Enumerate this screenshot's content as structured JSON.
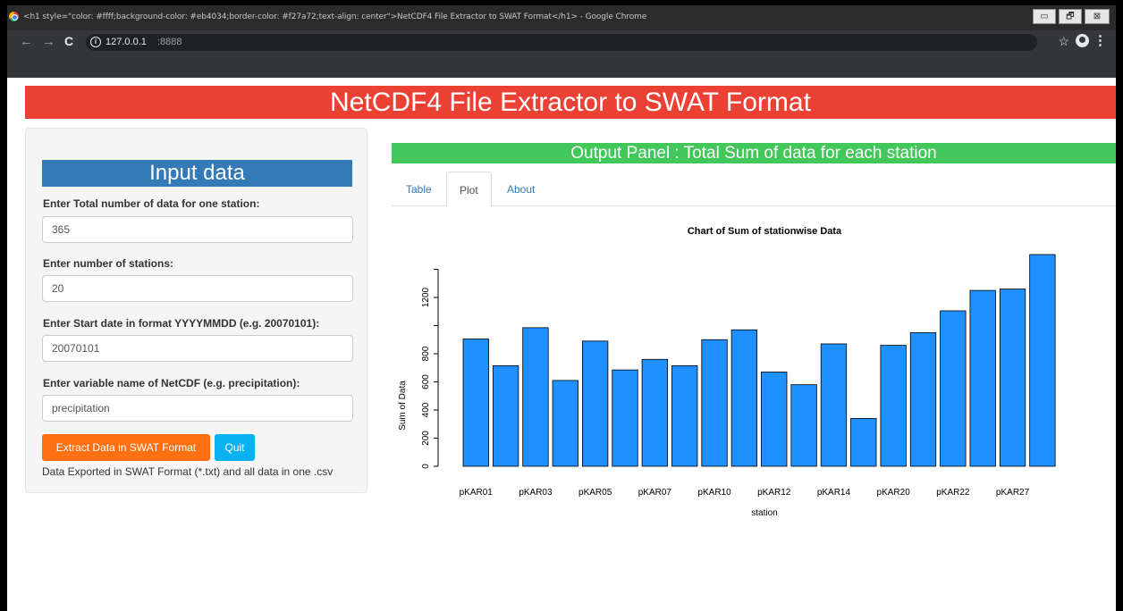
{
  "browser": {
    "window_title": "<h1 style=\"color: #ffff;background-color: #eb4034;border-color: #f27a72;text-align: center\">NetCDF4 File Extractor to SWAT Format</h1> - Google Chrome",
    "url_host": "127.0.0.1",
    "url_port": ":8888",
    "nav": {
      "back": "←",
      "forward": "→",
      "reload": "C"
    },
    "window_buttons": {
      "minimize": "▭",
      "maximize": "🗗",
      "close": "⊠"
    }
  },
  "app": {
    "title": "NetCDF4 File Extractor to SWAT Format",
    "title_color": "#eb4034"
  },
  "sidebar": {
    "heading": "Input data",
    "fields": [
      {
        "label": "Enter Total number of data for one station:",
        "value": "365"
      },
      {
        "label": "Enter number of stations:",
        "value": "20"
      },
      {
        "label": "Enter Start date in format YYYYMMDD (e.g. 20070101):",
        "value": "20070101"
      },
      {
        "label": "Enter variable name of NetCDF (e.g. precipitation):",
        "value": "precipitation"
      }
    ],
    "extract_button": "Extract Data in SWAT Format",
    "quit_button": "Quit",
    "export_message": "Data Exported in SWAT Format (*.txt) and all data in one .csv"
  },
  "output": {
    "heading": "Output Panel : Total Sum of data for each station",
    "tabs": [
      "Table",
      "Plot",
      "About"
    ],
    "active_tab": "Plot"
  },
  "chart_data": {
    "type": "bar",
    "title": "Chart of Sum of stationwise Data",
    "xlabel": "station",
    "ylabel": "Sum of Data",
    "ylim": [
      0,
      1400
    ],
    "yticks": [
      0,
      200,
      400,
      600,
      800,
      1200
    ],
    "tick_labels_shown": [
      "pKAR01",
      "pKAR03",
      "pKAR05",
      "pKAR07",
      "pKAR10",
      "pKAR12",
      "pKAR14",
      "pKAR20",
      "pKAR22",
      "pKAR27"
    ],
    "values": [
      905,
      715,
      985,
      610,
      890,
      685,
      760,
      715,
      900,
      970,
      670,
      580,
      870,
      340,
      860,
      950,
      1105,
      1250,
      1260,
      1505
    ],
    "bar_color": "#1e90ff"
  }
}
